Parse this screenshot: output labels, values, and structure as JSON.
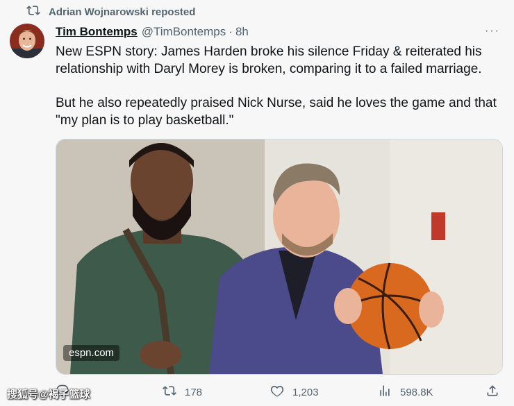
{
  "repost": {
    "text": "Adrian Wojnarowski reposted"
  },
  "tweet": {
    "author_name": "Tim Bontemps",
    "handle": "@TimBontemps",
    "separator": "·",
    "time": "8h",
    "more": "···",
    "paragraph1": "New ESPN story: James Harden broke his silence Friday & reiterated his relationship with Daryl Morey is broken, comparing it to a failed marriage.",
    "paragraph2": "But he also repeatedly praised Nick Nurse, said he loves the game and that \"my plan is to play basketball.\"",
    "media_watermark": "espn.com"
  },
  "actions": {
    "reposts": "178",
    "likes": "1,203",
    "views": "598.8K"
  },
  "source_watermark": "搜狐号@褐子篮球",
  "colors": {
    "text": "#0f1419",
    "secondary": "#536471",
    "background": "#f7f7f7"
  }
}
